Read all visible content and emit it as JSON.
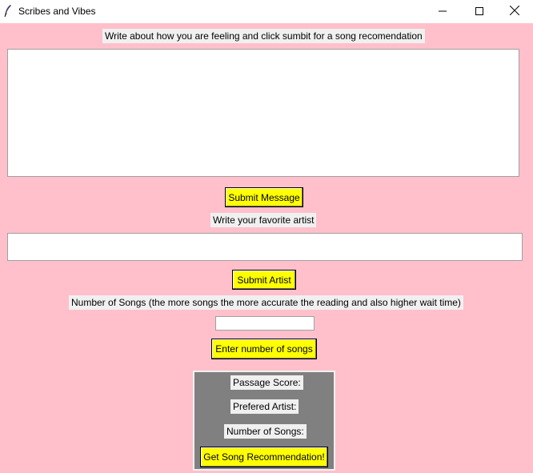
{
  "window": {
    "title": "Scribes and Vibes",
    "icon": "feather-icon",
    "controls": {
      "minimize": "minimize-icon",
      "maximize": "maximize-icon",
      "close": "close-icon"
    }
  },
  "message_section": {
    "prompt": "Write about how you are feeling and click sumbit for a song recomendation",
    "text_value": "",
    "submit_label": "Submit Message"
  },
  "artist_section": {
    "prompt": "Write your favorite artist",
    "value": "",
    "submit_label": "Submit Artist"
  },
  "songs_section": {
    "prompt": "Number of Songs (the more songs the more accurate the reading and also higher wait time)",
    "value": "",
    "submit_label": "Enter number of songs"
  },
  "results": {
    "passage_score_label": "Passage Score:",
    "preferred_artist_label": "Prefered Artist:",
    "number_of_songs_label": "Number of Songs:",
    "recommend_label": "Get Song Recommendation!"
  },
  "colors": {
    "background": "#FFC0CB",
    "button": "#FFFF00",
    "panel": "#808080",
    "label_bg": "#F0F0F0"
  }
}
